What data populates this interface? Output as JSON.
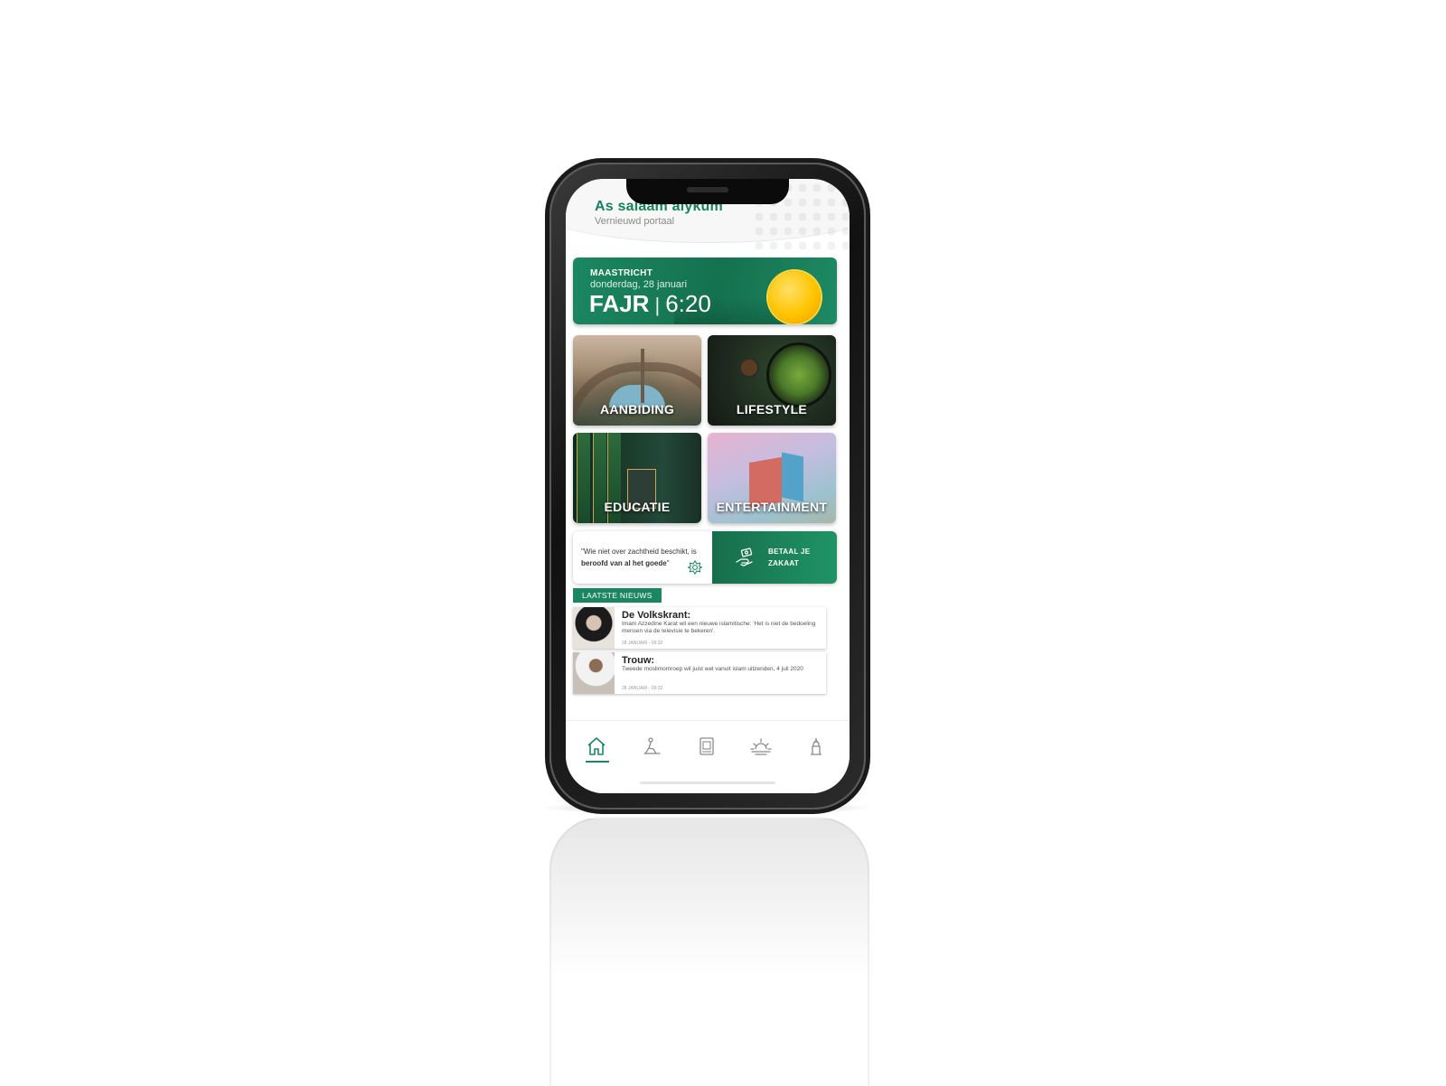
{
  "app": {
    "greeting_title": "As salaam alykum",
    "greeting_subtitle": "Vernieuwd portaal"
  },
  "prayer": {
    "city": "MAASTRICHT",
    "date": "donderdag, 28 januari",
    "name": "FAJR",
    "separator": "|",
    "time": "6:20"
  },
  "tiles": [
    {
      "label": "AANBIDING"
    },
    {
      "label": "LIFESTYLE"
    },
    {
      "label": "EDUCATIE"
    },
    {
      "label": "ENTERTAINMENT"
    }
  ],
  "quote": {
    "text_prefix": "\"Wie niet over zachtheid beschikt, is ",
    "text_bold": "beroofd van al het goede",
    "text_suffix": "\""
  },
  "zakaat": {
    "line1": "BETAAL JE",
    "line2": "ZAKAAT"
  },
  "news": {
    "section_label": "LAATSTE NIEUWS",
    "items": [
      {
        "source": "De Volkskrant:",
        "body": "Imam Azzedine Karat wil een nieuwe islamitische: 'Het is niet de bedoeling mensen via de televisie te bekeren'.",
        "date": "28 JANUARI - 09:32"
      },
      {
        "source": "Trouw:",
        "body": "Tweede moslimomroep wil juist wel vanuit islam uitzenden, 4 juli 2020",
        "date": "28 JANUARI - 09:32"
      }
    ]
  },
  "tabbar": {
    "items": [
      {
        "icon": "home-icon",
        "active": true
      },
      {
        "icon": "prayer-icon",
        "active": false
      },
      {
        "icon": "quran-icon",
        "active": false
      },
      {
        "icon": "sunrise-icon",
        "active": false
      },
      {
        "icon": "mosque-icon",
        "active": false
      }
    ]
  },
  "colors": {
    "accent": "#1b8762",
    "sun": "#ffc400"
  }
}
